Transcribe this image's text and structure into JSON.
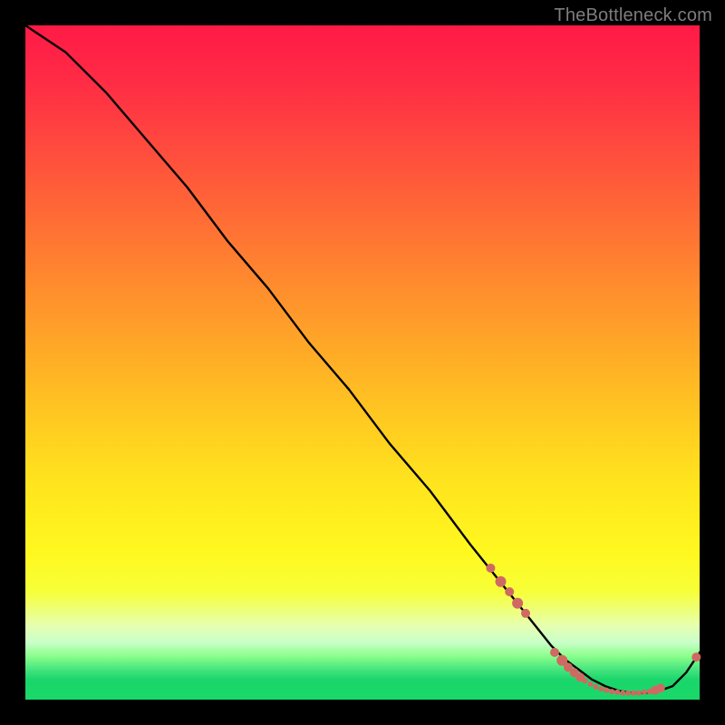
{
  "watermark": "TheBottleneck.com",
  "colors": {
    "background": "#000000",
    "curve": "#000000",
    "markers": "#cf6a62",
    "gradient_top": "#ff1a46",
    "gradient_bottom": "#19d869"
  },
  "chart_data": {
    "type": "line",
    "title": "",
    "xlabel": "",
    "ylabel": "",
    "xlim": [
      0,
      100
    ],
    "ylim": [
      0,
      100
    ],
    "grid": false,
    "legend": false,
    "series": [
      {
        "name": "bottleneck-curve",
        "x": [
          0,
          3,
          6,
          9,
          12,
          18,
          24,
          30,
          36,
          42,
          48,
          54,
          60,
          66,
          70,
          74,
          78,
          80,
          82,
          84,
          86,
          88,
          90,
          92,
          94,
          96,
          98,
          100
        ],
        "values": [
          100,
          98,
          96,
          93,
          90,
          83,
          76,
          68,
          61,
          53,
          46,
          38,
          31,
          23,
          18,
          13,
          8,
          6,
          4.5,
          3,
          2,
          1.3,
          1,
          1,
          1.3,
          2,
          4,
          7
        ]
      }
    ],
    "markers": [
      {
        "x": 69.0,
        "y": 19.5,
        "r": 5
      },
      {
        "x": 70.5,
        "y": 17.5,
        "r": 6
      },
      {
        "x": 71.8,
        "y": 16.0,
        "r": 5
      },
      {
        "x": 73.0,
        "y": 14.3,
        "r": 6
      },
      {
        "x": 74.2,
        "y": 12.8,
        "r": 5
      },
      {
        "x": 78.5,
        "y": 7.0,
        "r": 5
      },
      {
        "x": 79.6,
        "y": 5.8,
        "r": 6
      },
      {
        "x": 80.5,
        "y": 4.8,
        "r": 5
      },
      {
        "x": 81.4,
        "y": 4.0,
        "r": 5
      },
      {
        "x": 82.3,
        "y": 3.3,
        "r": 5
      },
      {
        "x": 83.0,
        "y": 2.8,
        "r": 3
      },
      {
        "x": 83.8,
        "y": 2.3,
        "r": 3
      },
      {
        "x": 84.6,
        "y": 1.9,
        "r": 3
      },
      {
        "x": 85.4,
        "y": 1.6,
        "r": 3
      },
      {
        "x": 86.2,
        "y": 1.4,
        "r": 3
      },
      {
        "x": 87.0,
        "y": 1.2,
        "r": 3
      },
      {
        "x": 87.8,
        "y": 1.1,
        "r": 3
      },
      {
        "x": 88.6,
        "y": 1.0,
        "r": 3
      },
      {
        "x": 89.4,
        "y": 1.0,
        "r": 3
      },
      {
        "x": 90.2,
        "y": 1.0,
        "r": 3
      },
      {
        "x": 91.0,
        "y": 1.0,
        "r": 3
      },
      {
        "x": 91.8,
        "y": 1.1,
        "r": 3
      },
      {
        "x": 92.6,
        "y": 1.2,
        "r": 3
      },
      {
        "x": 93.4,
        "y": 1.4,
        "r": 5
      },
      {
        "x": 94.2,
        "y": 1.7,
        "r": 5
      },
      {
        "x": 99.5,
        "y": 6.3,
        "r": 5
      }
    ]
  }
}
